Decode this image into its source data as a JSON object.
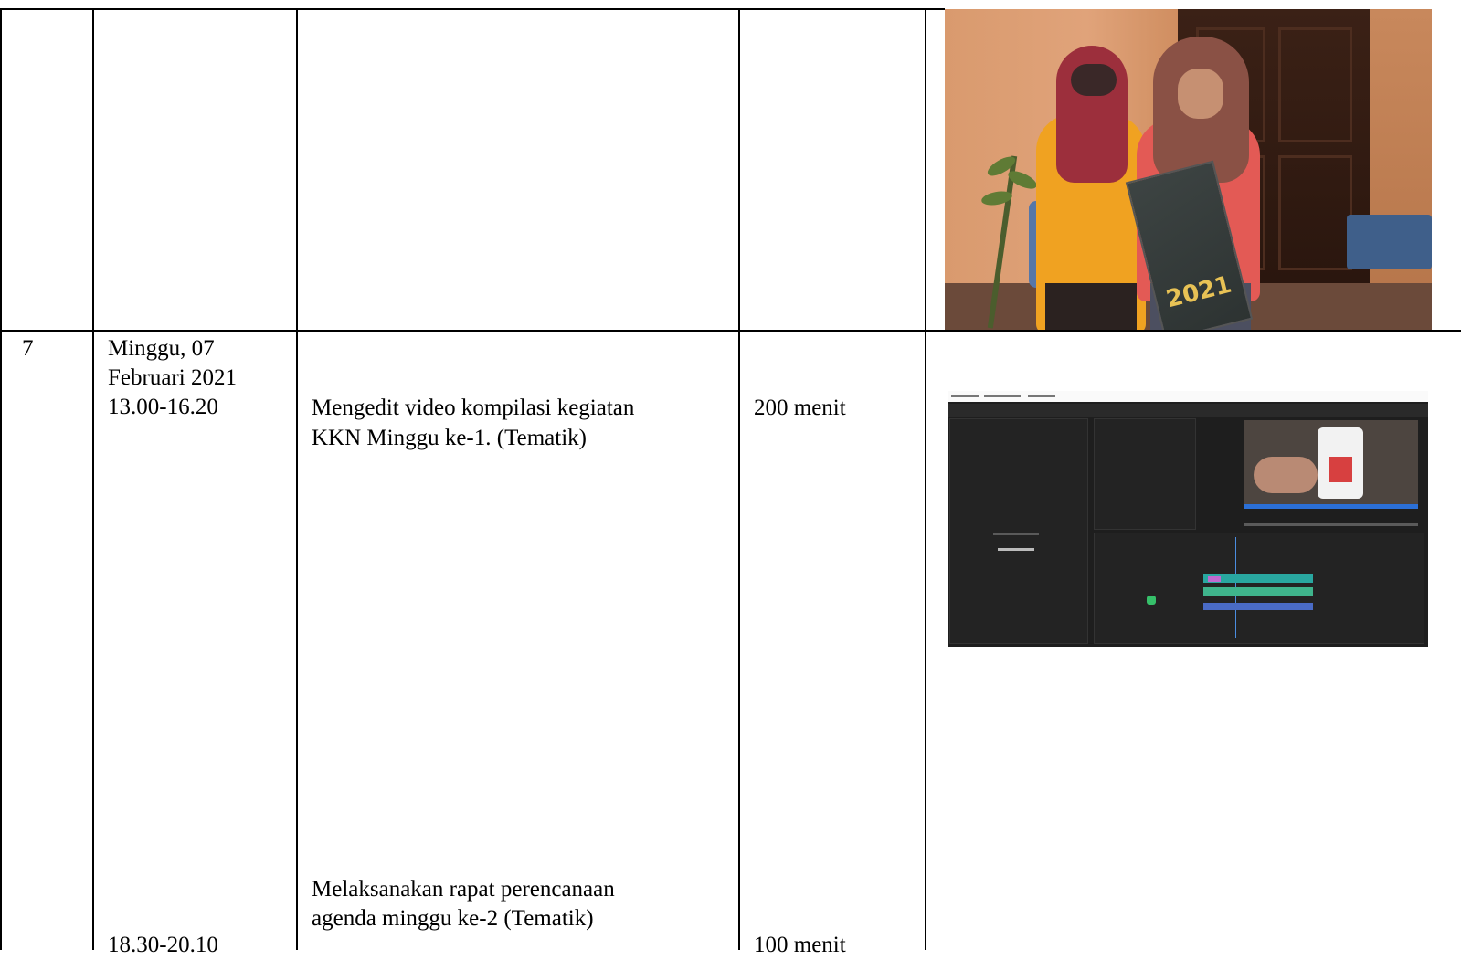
{
  "rows": [
    {
      "number": "",
      "date": "",
      "time_1": "",
      "activity_1": "",
      "duration_1": "",
      "time_2": "",
      "activity_2": "",
      "duration_2": ""
    },
    {
      "number": "7",
      "date_line_1": "Minggu, 07",
      "date_line_2": "Februari 2021",
      "time_1": "13.00-16.20",
      "activity_1_line_1": "Mengedit video kompilasi kegiatan",
      "activity_1_line_2": "KKN Minggu ke-1. (Tematik)",
      "duration_1": "200 menit",
      "time_2": "18.30-20.10",
      "activity_2_line_1": "Melaksanakan rapat perencanaan",
      "activity_2_line_2": "agenda minggu ke-2 (Tematik)",
      "duration_2": "100 menit"
    }
  ],
  "photos": {
    "row_1": "photo-two-women-holding-banner",
    "row_2": "screenshot-video-editor",
    "banner_text": "2021"
  }
}
